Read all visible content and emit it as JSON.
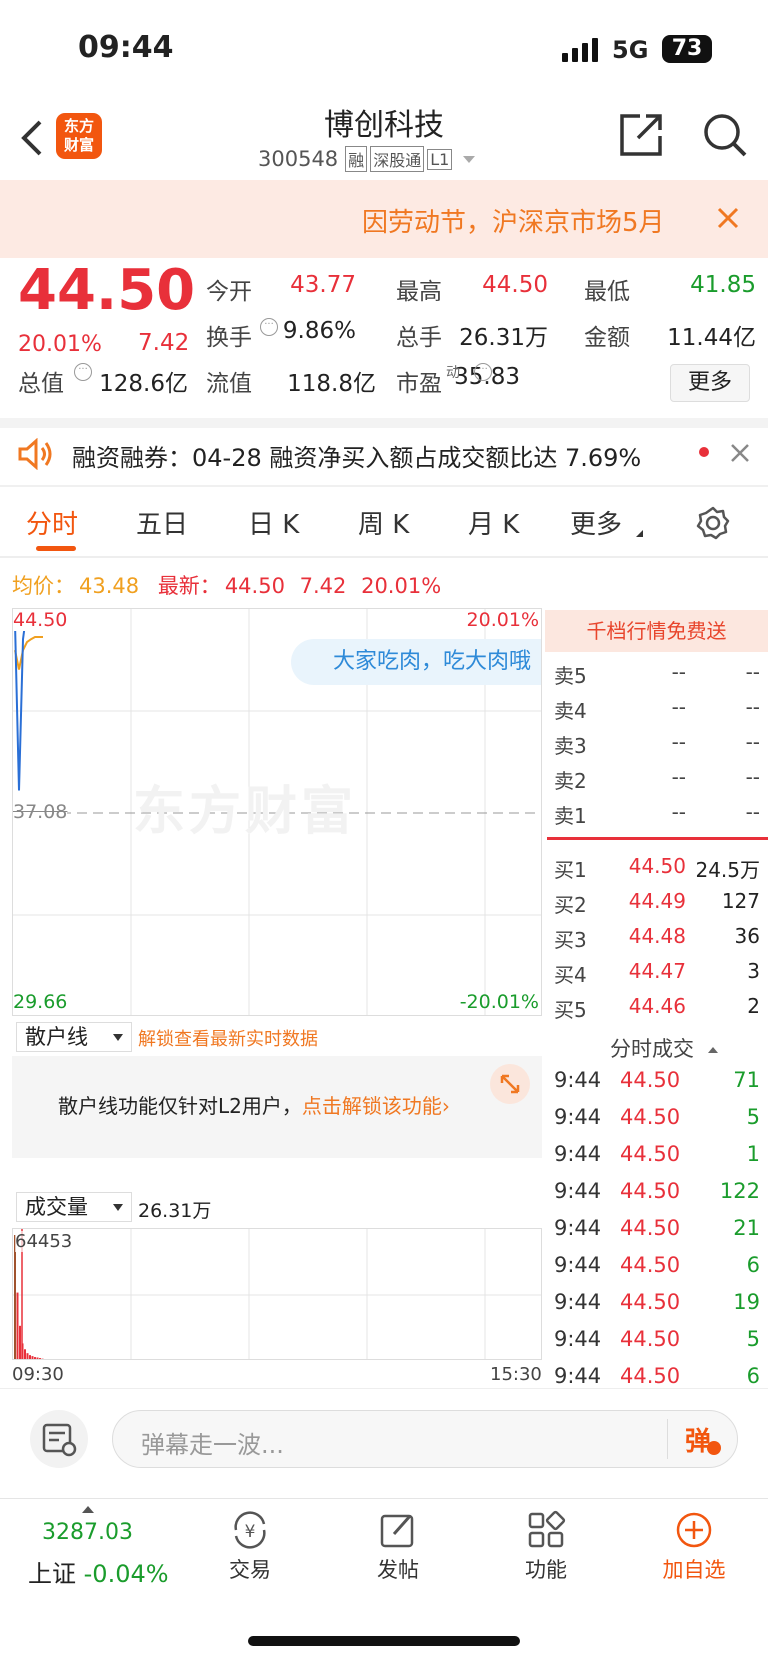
{
  "status": {
    "time": "09:44",
    "network": "5G",
    "battery": "73"
  },
  "header": {
    "logo_l1": "东方",
    "logo_l2": "财富",
    "title": "博创科技",
    "code": "300548",
    "badge1": "融",
    "badge2": "深股通",
    "badge3": "L1"
  },
  "notice": {
    "text": "因劳动节，沪深京市场5月"
  },
  "quote": {
    "price": "44.50",
    "pct": "20.01%",
    "chg": "7.42",
    "stats": [
      [
        "今开",
        "43.77"
      ],
      [
        "最高",
        "44.50"
      ],
      [
        "最低",
        "41.85"
      ],
      [
        "换手",
        "9.86%"
      ],
      [
        "总手",
        "26.31万"
      ],
      [
        "金额",
        "11.44亿"
      ],
      [
        "总值",
        "128.6亿"
      ],
      [
        "流值",
        "118.8亿"
      ],
      [
        "市盈",
        "35.83"
      ]
    ],
    "pe_sup": "动",
    "more": "更多"
  },
  "margin": {
    "text": "融资融券：04-28 融资净买入额占成交额比达 7.69%"
  },
  "tabs": [
    "分时",
    "五日",
    "日 K",
    "周 K",
    "月 K",
    "更多"
  ],
  "info": {
    "avg_label": "均价：",
    "avg": "43.48",
    "last_label": "最新：",
    "last": "44.50",
    "chg": "7.42",
    "pct": "20.01%"
  },
  "chart": {
    "top": "44.50",
    "top_pct": "20.01%",
    "mid": "37.08",
    "bottom": "29.66",
    "bottom_pct": "-20.01%",
    "watermark": "东方财富",
    "danmaku": "大家吃肉，吃大肉哦",
    "prices": [
      44.0,
      37.9,
      43.4,
      44.5,
      44.2,
      44.5,
      44.5,
      44.5
    ],
    "avgs": [
      43.0,
      42.3,
      43.0,
      43.3,
      43.4,
      43.48,
      43.48,
      43.48
    ],
    "range": [
      29.66,
      44.5
    ]
  },
  "retail": {
    "label": "散户线",
    "unlock": "解锁查看最新实时数据",
    "msg": "散户线功能仅针对L2用户，",
    "link": "点击解锁该功能"
  },
  "volume": {
    "label": "成交量",
    "total": "26.31万",
    "max": "64453",
    "start": "09:30",
    "end": "15:30",
    "bars": [
      64453,
      35000,
      18000,
      9000,
      6000,
      4000,
      3000,
      2500,
      2000,
      1800,
      1500,
      1200
    ]
  },
  "orderbook": {
    "promo": "千档行情免费送",
    "asks": [
      [
        "卖5",
        "--",
        "--"
      ],
      [
        "卖4",
        "--",
        "--"
      ],
      [
        "卖3",
        "--",
        "--"
      ],
      [
        "卖2",
        "--",
        "--"
      ],
      [
        "卖1",
        "--",
        "--"
      ]
    ],
    "bids": [
      [
        "买1",
        "44.50",
        "24.5万"
      ],
      [
        "买2",
        "44.49",
        "127"
      ],
      [
        "买3",
        "44.48",
        "36"
      ],
      [
        "买4",
        "44.47",
        "3"
      ],
      [
        "买5",
        "44.46",
        "2"
      ]
    ],
    "trades_label": "分时成交",
    "trades": [
      [
        "9:44",
        "44.50",
        "71"
      ],
      [
        "9:44",
        "44.50",
        "5"
      ],
      [
        "9:44",
        "44.50",
        "1"
      ],
      [
        "9:44",
        "44.50",
        "122"
      ],
      [
        "9:44",
        "44.50",
        "21"
      ],
      [
        "9:44",
        "44.50",
        "6"
      ],
      [
        "9:44",
        "44.50",
        "19"
      ],
      [
        "9:44",
        "44.50",
        "5"
      ],
      [
        "9:44",
        "44.50",
        "6"
      ]
    ]
  },
  "comment": {
    "placeholder": "弹幕走一波...",
    "btn": "弹"
  },
  "bottom": {
    "index_val": "3287.03",
    "index_name": "上证",
    "index_pct": "-0.04%",
    "trade": "交易",
    "post": "发帖",
    "func": "功能",
    "add": "加自选"
  }
}
